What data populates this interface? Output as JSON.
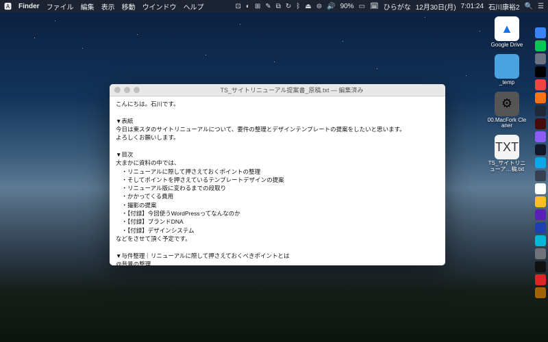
{
  "menubar": {
    "app": "Finder",
    "menus": [
      "ファイル",
      "編集",
      "表示",
      "移動",
      "ウインドウ",
      "ヘルプ"
    ],
    "battery": "90%",
    "ime": "ひらがな",
    "date": "12月30日(月)",
    "time": "7:01:24",
    "user": "石川康裕2"
  },
  "desktop": {
    "items": [
      {
        "label": "Google Drive",
        "cls": "gdrive",
        "glyph": "▲"
      },
      {
        "label": "_temp",
        "cls": "folder",
        "glyph": ""
      },
      {
        "label": "00.MacFork Cleaner",
        "cls": "cleaner",
        "glyph": "⚙"
      },
      {
        "label": "TS_サイトリニューア…稿.txt",
        "cls": "txtfile",
        "glyph": "TXT"
      }
    ]
  },
  "window": {
    "title": "TS_サイトリニューアル提案書_原稿.txt — 編集済み",
    "content": "こんにちは。石川です。\n\n▼表紙\n今日は東スタのサイトリニューアルについて、要件の整理とデザインテンプレートの提案をしたいと思います。\nよろしくお願いします。\n\n▼目次\n大まかに資料の中では、\n　・リニューアルに際して押さえておくポイントの整理\n　・そしてポイントを押さえているテンプレートデザインの提案\n　・リニューアル版に変わるまでの段取り\n　・かかってくる費用\n　・撮影の提案\n　・【付録】今回使うWordPressってなんなのか\n　・【付録】ブランドDNA\n　・【付録】デザインシステム\nなどをさせて頂く予定です。\n\n▼与件整理｜リニューアルに際して押さえておくべきポイントとは\n@背景の整理\nそれでは与件整理から始めていきます。\n今回のきっかけはWiXでのサイトのメンテナンスにいくつか不都合があったことが発端です。\nデータ容量の上限の都合で画像をあまり掲載できない、スマホ用に追加更新が必要になるなど面倒、カスタマイズがしにくく不便、などの問題がありました。WiX自体も「無料」と銘打ってますが、実際にはいくらか課金している状況です。"
  },
  "dock_colors": [
    "#3b82f6",
    "#06c755",
    "#6b7280",
    "#000000",
    "#ef4444",
    "#f97316",
    "#1f2937",
    "#450a0a",
    "#8b5cf6",
    "#111827",
    "#0ea5e9",
    "#374151",
    "#ffffff",
    "#fbbf24",
    "#5b21b6",
    "#1e40af",
    "#06b6d4",
    "#71717a",
    "#111111",
    "#dc2626",
    "#a16207"
  ]
}
